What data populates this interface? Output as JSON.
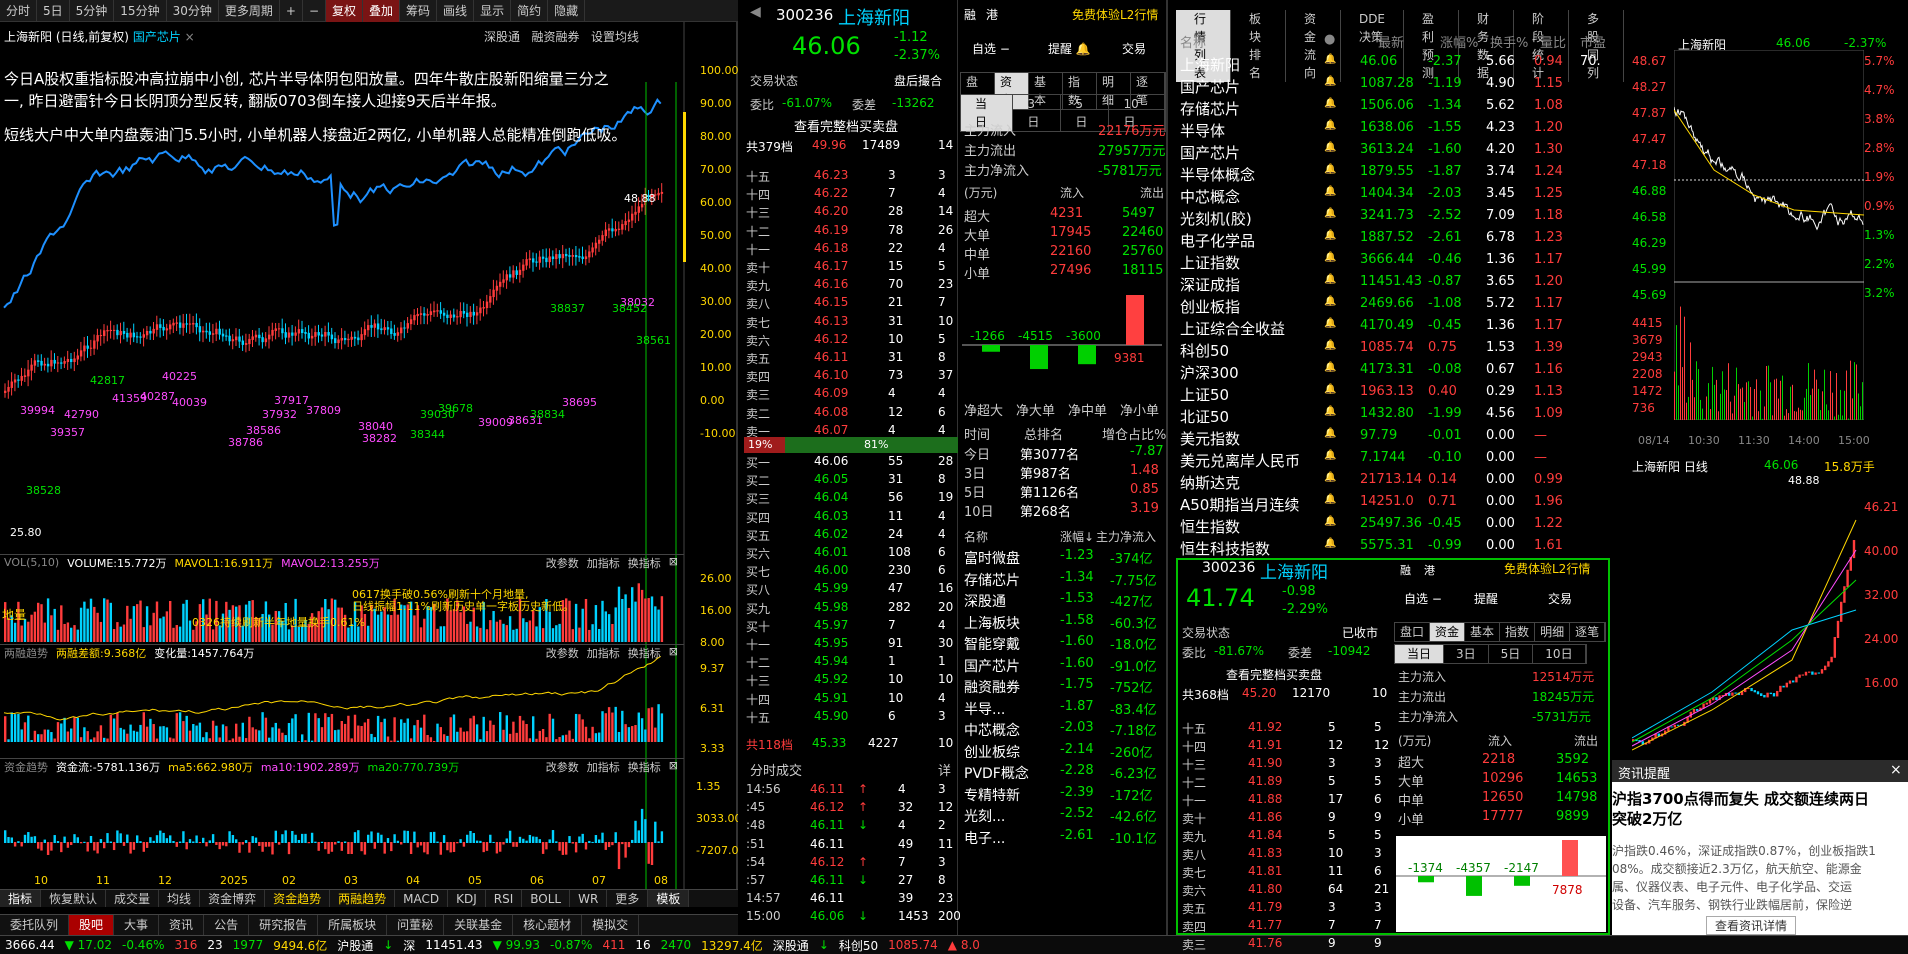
{
  "toolbar": [
    "分时",
    "5日",
    "5分钟",
    "15分钟",
    "30分钟",
    "更多周期",
    "+",
    "−",
    "复权",
    "叠加",
    "筹码",
    "画线",
    "显示",
    "简约",
    "隐藏"
  ],
  "chart": {
    "header": "上海新阳 (日线,前复权)",
    "tag": "国产芯片",
    "tabs": [
      "深股通",
      "融资融券",
      "设置均线"
    ],
    "ann1": "今日A股权重指标股冲高拉崩中小创, 芯片半导体阴包阳放量。四年牛散庄股新阳缩量三分之",
    "ann2": "一, 昨日避雷针今日长阴顶分型反转, 翻版0703倒车接人迎接9天后半年报。",
    "ann3": "短线大户中大单内盘轰油门5.5小时, 小单机器人接盘近2两亿, 小单机器人总能精准倒跑低吸。",
    "yaxis": [
      "100.00",
      "90.00",
      "80.00",
      "70.00",
      "60.00",
      "50.00",
      "40.00",
      "30.00",
      "20.00",
      "10.00",
      "0.00",
      "-10.00"
    ],
    "price_labels": [
      "48.88",
      "25.80",
      "38528",
      "39357",
      "42790",
      "41359",
      "40287",
      "40225",
      "40039",
      "38786",
      "38586",
      "37932",
      "37917",
      "37809",
      "38040",
      "38282",
      "39030",
      "38344",
      "39678",
      "39009",
      "38631",
      "38695",
      "38837",
      "38032",
      "38452",
      "38561",
      "42817",
      "39994",
      "38834"
    ],
    "vol_hdr": "VOL(5,10)",
    "vol_val": "VOLUME:15.772万",
    "mavol1": "MAVOL1:16.911万",
    "mavol2": "MAVOL2:13.255万",
    "vol_links": [
      "改参数",
      "加指标",
      "换指标"
    ],
    "vol_ann1": "0617换手破0.56%刷新十个月地量,",
    "vol_ann2": "日线振幅1.11%刷新历史单一字板历史新低。",
    "vol_ann3": "0326持续刷新半年地量换手0.61%",
    "vol_ann4": "地量",
    "vol_y": [
      "26.00",
      "16.00",
      "8.00"
    ],
    "rz_hdr": "两融趋势",
    "rz_val": "两融差额:9.368亿",
    "rz_chg": "变化量:1457.764万",
    "rz_y": [
      "9.37",
      "6.31",
      "3.33"
    ],
    "zj_hdr": "资金趋势",
    "zj_val": "资金流:-5781.136万",
    "zj_ma5": "ma5:662.980万",
    "zj_ma10": "ma10:1902.289万",
    "zj_ma20": "ma20:770.739万",
    "zj_y": [
      "1.35",
      "3033.00",
      "-7207.00"
    ],
    "xaxis": [
      "10",
      "11",
      "12",
      "2025",
      "02",
      "03",
      "04",
      "05",
      "06",
      "07",
      "08"
    ]
  },
  "bottom_tabs": [
    "指标",
    "恢复默认",
    "成交量",
    "均线",
    "资金博弈",
    "资金趋势",
    "两融趋势",
    "MACD",
    "KDJ",
    "RSI",
    "BOLL",
    "WR",
    "更多",
    "模板"
  ],
  "bottom_tabs2": [
    "委托队列",
    "股吧",
    "大事",
    "资讯",
    "公告",
    "研究报告",
    "所属板块",
    "问董秘",
    "关联基金",
    "核心题材",
    "模拟交"
  ],
  "status": [
    {
      "t": "3666.44",
      "c": "wht"
    },
    {
      "t": "▼ 17.02",
      "c": "grn"
    },
    {
      "t": "-0.46%",
      "c": "grn"
    },
    {
      "t": "316",
      "c": "red"
    },
    {
      "t": "23",
      "c": "wht"
    },
    {
      "t": "1977",
      "c": "grn"
    },
    {
      "t": "9494.6亿",
      "c": "yel"
    },
    {
      "t": "沪股通",
      "c": "wht"
    },
    {
      "t": "↓",
      "c": "grn"
    },
    {
      "t": "深",
      "c": "wht"
    },
    {
      "t": "11451.43",
      "c": "wht"
    },
    {
      "t": "▼ 99.93",
      "c": "grn"
    },
    {
      "t": "-0.87%",
      "c": "grn"
    },
    {
      "t": "411",
      "c": "red"
    },
    {
      "t": "16",
      "c": "wht"
    },
    {
      "t": "2470",
      "c": "grn"
    },
    {
      "t": "13297.4亿",
      "c": "yel"
    },
    {
      "t": "深股通",
      "c": "wht"
    },
    {
      "t": "↓",
      "c": "grn"
    },
    {
      "t": "科创50",
      "c": "wht"
    },
    {
      "t": "1085.74",
      "c": "red"
    },
    {
      "t": "▲ 8.0",
      "c": "red"
    }
  ],
  "stock1": {
    "code": "300236",
    "name": "上海新阳",
    "price": "46.06",
    "chg": "-1.12",
    "pct": "-2.37%",
    "rzr": "融",
    "gang": "港",
    "free": "免费体验L2行情",
    "btn_self": "自选 −",
    "btn_warn": "提醒",
    "btn_trade": "交易",
    "state": "交易状态",
    "state_v": "盘后撮合",
    "wb": "委比",
    "wb_v": "-61.07%",
    "wc": "委差",
    "wc_v": "-13262",
    "l2": "查看完整档买卖盘",
    "total_sell": "共379档",
    "ts_p": "49.96",
    "ts_v": "17489",
    "ts_n": "14",
    "asks": [
      [
        "十五",
        "46.23",
        "3",
        "3"
      ],
      [
        "十四",
        "46.22",
        "7",
        "4"
      ],
      [
        "十三",
        "46.20",
        "28",
        "14"
      ],
      [
        "十二",
        "46.19",
        "78",
        "26"
      ],
      [
        "十一",
        "46.18",
        "22",
        "4"
      ],
      [
        "卖十",
        "46.17",
        "15",
        "5"
      ],
      [
        "卖九",
        "46.16",
        "70",
        "23"
      ],
      [
        "卖八",
        "46.15",
        "21",
        "7"
      ],
      [
        "卖七",
        "46.13",
        "31",
        "10"
      ],
      [
        "卖六",
        "46.12",
        "10",
        "5"
      ],
      [
        "卖五",
        "46.11",
        "31",
        "8"
      ],
      [
        "卖四",
        "46.10",
        "73",
        "37"
      ],
      [
        "卖三",
        "46.09",
        "4",
        "4"
      ],
      [
        "卖二",
        "46.08",
        "12",
        "6"
      ],
      [
        "卖一",
        "46.07",
        "4",
        "4"
      ]
    ],
    "ratio_l": "19%",
    "ratio_r": "81%",
    "bids": [
      [
        "买一",
        "46.06",
        "55",
        "28"
      ],
      [
        "买二",
        "46.05",
        "31",
        "8"
      ],
      [
        "买三",
        "46.04",
        "56",
        "19"
      ],
      [
        "买四",
        "46.03",
        "11",
        "4"
      ],
      [
        "买五",
        "46.02",
        "24",
        "4"
      ],
      [
        "买六",
        "46.01",
        "108",
        "6"
      ],
      [
        "买七",
        "46.00",
        "230",
        "6"
      ],
      [
        "买八",
        "45.99",
        "47",
        "16"
      ],
      [
        "买九",
        "45.98",
        "282",
        "20"
      ],
      [
        "买十",
        "45.97",
        "7",
        "4"
      ],
      [
        "十一",
        "45.95",
        "91",
        "30"
      ],
      [
        "十二",
        "45.94",
        "1",
        "1"
      ],
      [
        "十三",
        "45.92",
        "10",
        "10"
      ],
      [
        "十四",
        "45.91",
        "10",
        "4"
      ],
      [
        "十五",
        "45.90",
        "6",
        "3"
      ]
    ],
    "total_buy": "共118档",
    "tb_p": "45.33",
    "tb_v": "4227",
    "tb_n": "10",
    "fs": "分时成交",
    "fs_more": "详",
    "ticks": [
      [
        "14:56",
        "46.11",
        "↑",
        "4",
        "3"
      ],
      [
        ":45",
        "46.12",
        "↑",
        "32",
        "12"
      ],
      [
        ":48",
        "46.11",
        "↓",
        "4",
        "2"
      ],
      [
        ":51",
        "46.11",
        "",
        "49",
        "11"
      ],
      [
        ":54",
        "46.12",
        "↑",
        "7",
        "3"
      ],
      [
        ":57",
        "46.11",
        "↓",
        "27",
        "8"
      ],
      [
        "14:57",
        "46.11",
        "",
        "39",
        "23"
      ],
      [
        "15:00",
        "46.06",
        "↓",
        "1453",
        "200"
      ]
    ],
    "tabs": [
      "盘口",
      "资金",
      "基本",
      "指数",
      "明细",
      "逐笔"
    ],
    "tabs2": [
      "当日",
      "3日",
      "5日",
      "10日"
    ],
    "flow_in": "主力流入",
    "flow_in_v": "22176万元",
    "flow_out": "主力流出",
    "flow_out_v": "27957万元",
    "flow_net": "主力净流入",
    "flow_net_v": "-5781万元",
    "ft_hd": [
      "(万元)",
      "流入",
      "流出"
    ],
    "ft": [
      [
        "超大",
        "4231",
        "5497"
      ],
      [
        "大单",
        "17945",
        "22460"
      ],
      [
        "中单",
        "22160",
        "25760"
      ],
      [
        "小单",
        "27496",
        "18115"
      ]
    ],
    "bars": [
      "-1266",
      "-4515",
      "-3600",
      "9381"
    ],
    "bar_lbl": [
      "净超大",
      "净大单",
      "净中单",
      "净小单"
    ],
    "rank_hd": [
      "时间",
      "总排名",
      "增仓占比%"
    ],
    "rank": [
      [
        "今日",
        "第3077名",
        "-7.87"
      ],
      [
        "3日",
        "第987名",
        "1.48"
      ],
      [
        "5日",
        "第1126名",
        "0.85"
      ],
      [
        "10日",
        "第268名",
        "3.19"
      ]
    ],
    "sec_hd": [
      "名称",
      "涨幅↓",
      "主力净流入"
    ],
    "sectors": [
      [
        "富时微盘",
        "-1.23",
        "-374亿"
      ],
      [
        "存储芯片",
        "-1.34",
        "-7.75亿"
      ],
      [
        "深股通",
        "-1.53",
        "-427亿"
      ],
      [
        "上海板块",
        "-1.58",
        "-60.3亿"
      ],
      [
        "智能穿戴",
        "-1.60",
        "-18.0亿"
      ],
      [
        "国产芯片",
        "-1.60",
        "-91.0亿"
      ],
      [
        "融资融券",
        "-1.75",
        "-752亿"
      ],
      [
        "半导...",
        "-1.87",
        "-83.4亿"
      ],
      [
        "中芯概念",
        "-2.03",
        "-7.18亿"
      ],
      [
        "创业板综",
        "-2.14",
        "-260亿"
      ],
      [
        "PVDF概念",
        "-2.28",
        "-6.23亿"
      ],
      [
        "专精特新",
        "-2.39",
        "-172亿"
      ],
      [
        "光刻...",
        "-2.52",
        "-42.6亿"
      ],
      [
        "电子...",
        "-2.61",
        "-10.1亿"
      ]
    ]
  },
  "list": {
    "tabs": [
      "行情列表",
      "板块排名",
      "资金流向",
      "DDE决策",
      "盈利预测",
      "财务数据",
      "阶段统计",
      "多股同列"
    ],
    "hd": [
      "名称",
      "●",
      "最新",
      "涨幅%",
      "换手%",
      "量比",
      "市盈"
    ],
    "rows": [
      [
        "上海新阳",
        "46.06",
        "-2.37",
        "5.66",
        "0.94",
        "70."
      ],
      [
        "国产芯片",
        "1087.28",
        "-1.19",
        "4.90",
        "1.15",
        ""
      ],
      [
        "存储芯片",
        "1506.06",
        "-1.34",
        "5.62",
        "1.08",
        ""
      ],
      [
        "半导体",
        "1638.06",
        "-1.55",
        "4.23",
        "1.20",
        ""
      ],
      [
        "国产芯片",
        "3613.24",
        "-1.60",
        "4.20",
        "1.30",
        ""
      ],
      [
        "半导体概念",
        "1879.55",
        "-1.87",
        "3.74",
        "1.24",
        ""
      ],
      [
        "中芯概念",
        "1404.34",
        "-2.03",
        "3.45",
        "1.25",
        ""
      ],
      [
        "光刻机(胶)",
        "3241.73",
        "-2.52",
        "7.09",
        "1.18",
        ""
      ],
      [
        "电子化学品",
        "1887.52",
        "-2.61",
        "6.78",
        "1.23",
        ""
      ],
      [
        "上证指数",
        "3666.44",
        "-0.46",
        "1.36",
        "1.17",
        ""
      ],
      [
        "深证成指",
        "11451.43",
        "-0.87",
        "3.65",
        "1.20",
        ""
      ],
      [
        "创业板指",
        "2469.66",
        "-1.08",
        "5.72",
        "1.17",
        ""
      ],
      [
        "上证综合全收益",
        "4170.49",
        "-0.45",
        "1.36",
        "1.17",
        ""
      ],
      [
        "科创50",
        "1085.74",
        "0.75",
        "1.53",
        "1.39",
        ""
      ],
      [
        "沪深300",
        "4173.31",
        "-0.08",
        "0.67",
        "1.16",
        ""
      ],
      [
        "上证50",
        "1963.13",
        "0.40",
        "0.29",
        "1.13",
        ""
      ],
      [
        "北证50",
        "1432.80",
        "-1.99",
        "4.56",
        "1.09",
        ""
      ],
      [
        "美元指数",
        "97.79",
        "-0.01",
        "0.00",
        "—",
        ""
      ],
      [
        "美元兑离岸人民币",
        "7.1744",
        "-0.10",
        "0.00",
        "—",
        ""
      ],
      [
        "纳斯达克",
        "21713.14",
        "0.14",
        "0.00",
        "0.99",
        ""
      ],
      [
        "A50期指当月连续",
        "14251.0",
        "0.71",
        "0.00",
        "1.96",
        ""
      ],
      [
        "恒生指数",
        "25497.36",
        "-0.45",
        "0.00",
        "1.22",
        ""
      ],
      [
        "恒生科技指数",
        "5575.31",
        "-0.99",
        "0.00",
        "1.61",
        ""
      ]
    ]
  },
  "mini": {
    "name": "上海新阳",
    "price": "46.06",
    "pct": "-2.37%",
    "y": [
      "48.67",
      "48.27",
      "47.87",
      "47.47",
      "47.18",
      "46.88",
      "46.58",
      "46.29",
      "45.99",
      "45.69"
    ],
    "yr": [
      "5.7%",
      "4.7%",
      "3.8%",
      "2.8%",
      "1.9%",
      "0.9%",
      "1.3%",
      "2.2%",
      "3.2%"
    ],
    "vy": [
      "4415",
      "3679",
      "2943",
      "2208",
      "1472",
      "736"
    ],
    "x": [
      "08/14",
      "10:30",
      "11:30",
      "14:00",
      "15:00"
    ],
    "day": "上海新阳 日线",
    "day_p": "46.06",
    "day_v": "15.8万手",
    "day_hi": "48.88",
    "day_y": [
      "46.21",
      "40.00",
      "32.00",
      "24.00",
      "16.00"
    ]
  },
  "stock2": {
    "code": "300236",
    "name": "上海新阳",
    "price": "41.74",
    "chg": "-0.98",
    "pct": "-2.29%",
    "state_v": "已收市",
    "wb_v": "-81.67%",
    "wc_v": "-10942",
    "total": "共368档",
    "ts_p": "45.20",
    "ts_v": "12170",
    "ts_n": "10",
    "asks": [
      [
        "十五",
        "41.92",
        "5",
        "5"
      ],
      [
        "十四",
        "41.91",
        "12",
        "12"
      ],
      [
        "十三",
        "41.90",
        "3",
        "3"
      ],
      [
        "十二",
        "41.89",
        "5",
        "5"
      ],
      [
        "十一",
        "41.88",
        "17",
        "6"
      ],
      [
        "卖十",
        "41.86",
        "9",
        "9"
      ],
      [
        "卖九",
        "41.84",
        "5",
        "5"
      ],
      [
        "卖八",
        "41.83",
        "10",
        "3"
      ],
      [
        "卖七",
        "41.81",
        "11",
        "6"
      ],
      [
        "卖六",
        "41.80",
        "64",
        "21"
      ],
      [
        "卖五",
        "41.79",
        "3",
        "3"
      ],
      [
        "卖四",
        "41.77",
        "7",
        "7"
      ],
      [
        "卖三",
        "41.76",
        "9",
        "9"
      ]
    ],
    "flow_in_v": "12514万元",
    "flow_out_v": "18245万元",
    "flow_net_v": "-5731万元",
    "ft": [
      [
        "超大",
        "2218",
        "3592"
      ],
      [
        "大单",
        "10296",
        "14653"
      ],
      [
        "中单",
        "12650",
        "14798"
      ],
      [
        "小单",
        "17777",
        "9899"
      ]
    ],
    "bars": [
      "-1374",
      "-4357",
      "-2147",
      "7878"
    ]
  },
  "news": {
    "title": "资讯提醒",
    "headline1": "沪指3700点得而复失  成交额连续两日",
    "headline2": "突破2万亿",
    "body1": "沪指跌0.46%，深证成指跌0.87%，创业板指跌1",
    "body2": "08%。成交额接近2.3万亿，航天航空、能源金",
    "body3": "属、仪器仪表、电子元件、电子化学品、交运",
    "body4": "设备、汽车服务、钢铁行业跌幅居前，保险逆",
    "more": "查看资讯详情"
  }
}
